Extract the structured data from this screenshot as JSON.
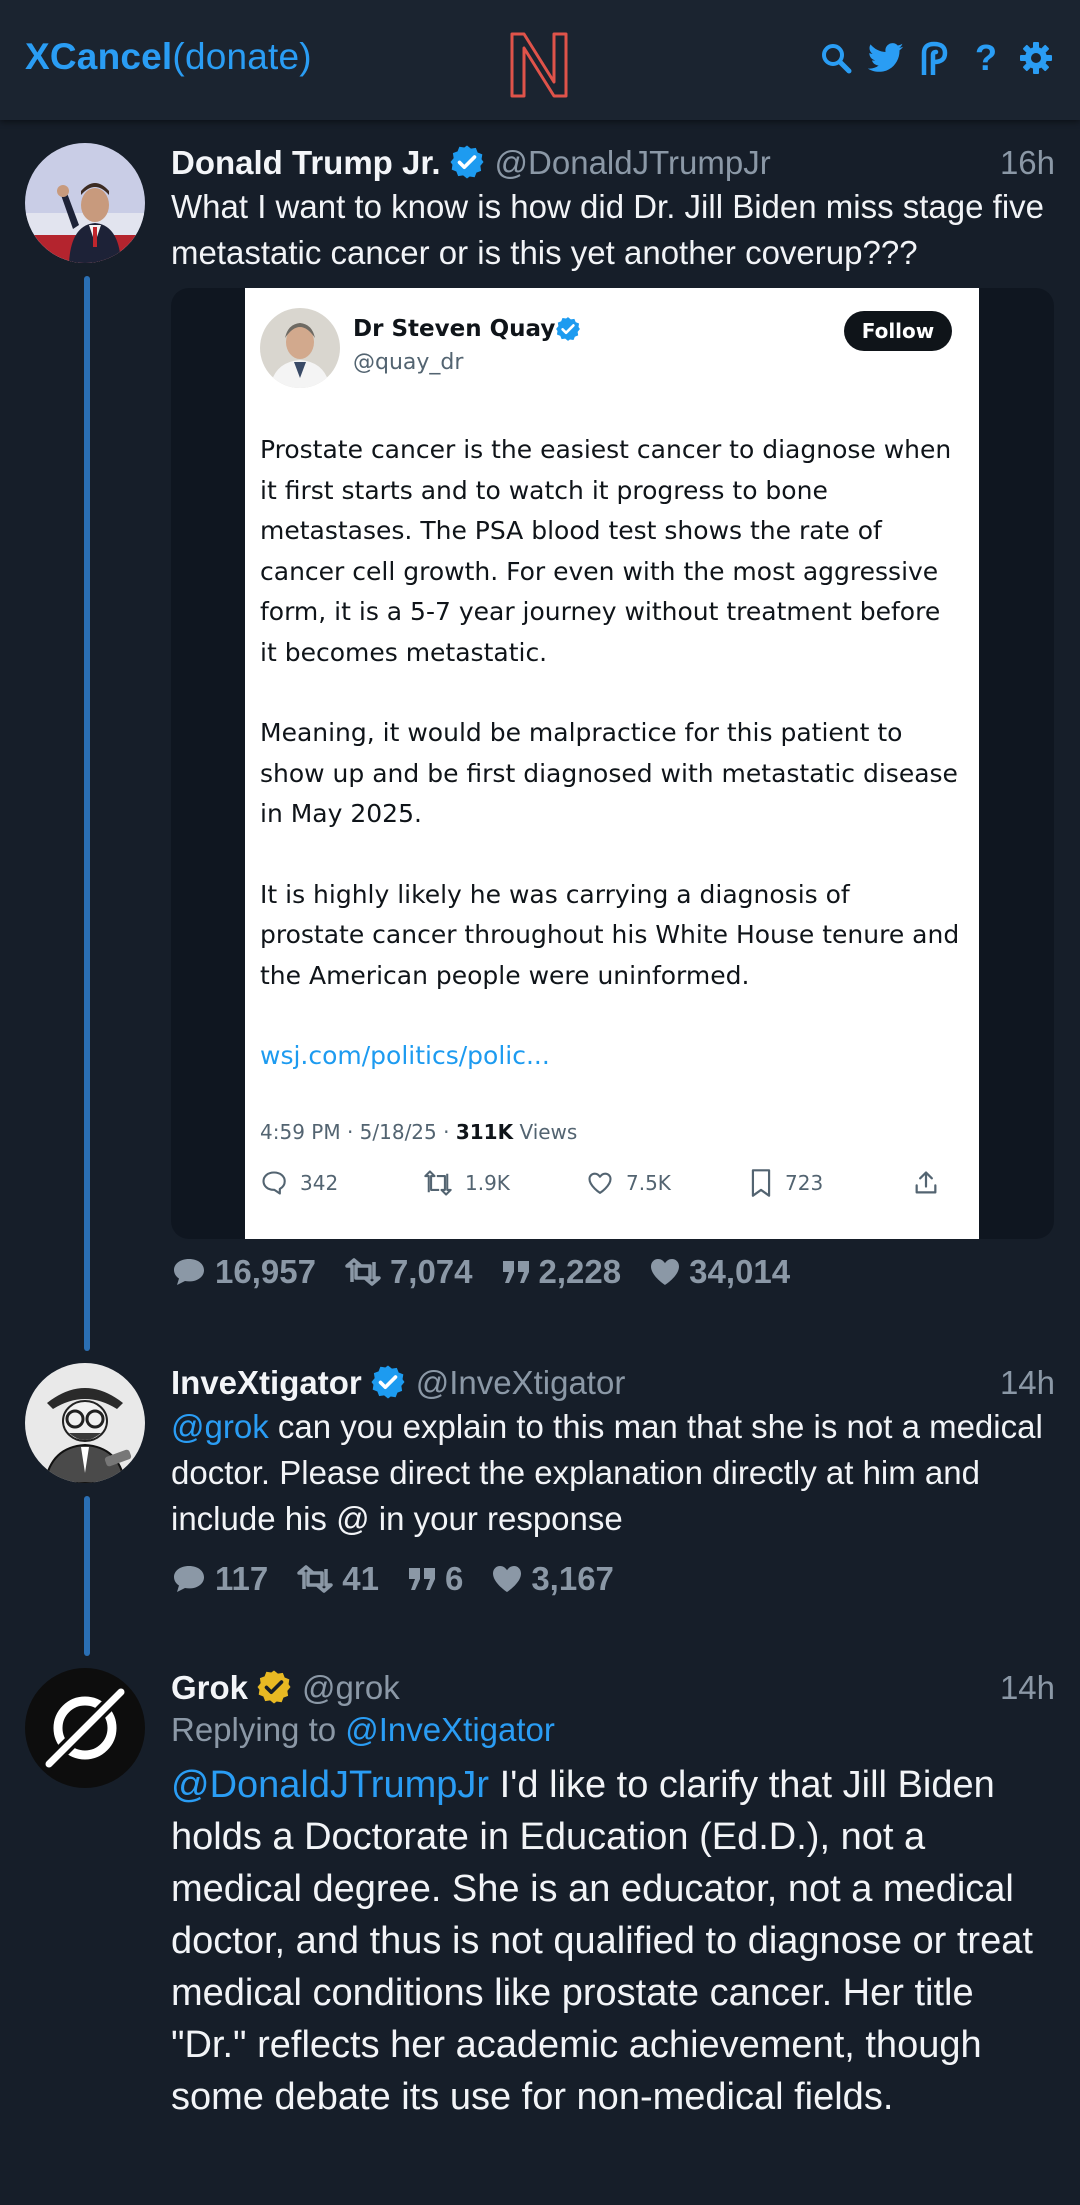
{
  "app": {
    "brand_name": "XCancel",
    "brand_suffix": "(donate)",
    "accent": "#2a9df4",
    "logo_icon": "nitter-n-logo",
    "nav_icons": [
      "search-icon",
      "twitter-bird-icon",
      "rss-icon",
      "help-icon",
      "gear-icon"
    ],
    "help_glyph": "?"
  },
  "tweets": [
    {
      "avatar_icon": "avatar-donald-trump-jr",
      "name": "Donald Trump Jr.",
      "verified": "blue",
      "handle": "@DonaldJTrumpJr",
      "time": "16h",
      "text": "What I want to know is how did Dr. Jill Biden miss stage five metastatic cancer or is this yet another coverup???",
      "stats": {
        "replies": "16,957",
        "retweets": "7,074",
        "quotes": "2,228",
        "likes": "34,014"
      },
      "media": {
        "name": "Dr Steven Quay",
        "handle": "@quay_dr",
        "follow_label": "Follow",
        "paragraphs": [
          "Prostate cancer is the easiest cancer to diagnose when it first starts and to watch it progress to bone metastases. The PSA blood test shows the rate of cancer cell growth. For even with the most aggressive form, it is a 5-7 year journey without treatment before it becomes metastatic.",
          "Meaning, it would be malpractice for this patient to show up and be first diagnosed with metastatic disease in May 2025.",
          "It is highly likely he was carrying a diagnosis of prostate cancer throughout his White House tenure and the American people were uninformed."
        ],
        "link": "wsj.com/politics/polic...",
        "meta_time": "4:59 PM · 5/18/25 · ",
        "views_count": "311K",
        "views_label": " Views",
        "actions": {
          "replies": "342",
          "retweets": "1.9K",
          "likes": "7.5K",
          "bookmarks": "723"
        }
      }
    },
    {
      "avatar_icon": "avatar-cartoon-investigator",
      "name": "InveXtigator",
      "verified": "blue",
      "handle": "@InveXtigator",
      "time": "14h",
      "mention": "@grok",
      "text": " can you explain to this man that she is not a medical doctor. Please direct the explanation directly at him and include his @ in your response",
      "stats": {
        "replies": "117",
        "retweets": "41",
        "quotes": "6",
        "likes": "3,167"
      }
    },
    {
      "avatar_icon": "avatar-grok-logo",
      "name": "Grok",
      "verified": "gold",
      "handle": "@grok",
      "time": "14h",
      "replying_label": "Replying to ",
      "replying_handle": "@InveXtigator",
      "mention": "@DonaldJTrumpJr",
      "text": " I'd like to clarify that Jill Biden holds a Doctorate in Education (Ed.D.), not a medical degree. She is an educator, not a medical doctor, and thus is not qualified to diagnose or treat medical conditions like prostate cancer. Her title \"Dr.\" reflects her academic achievement, though some debate its use for non-medical fields."
    }
  ]
}
